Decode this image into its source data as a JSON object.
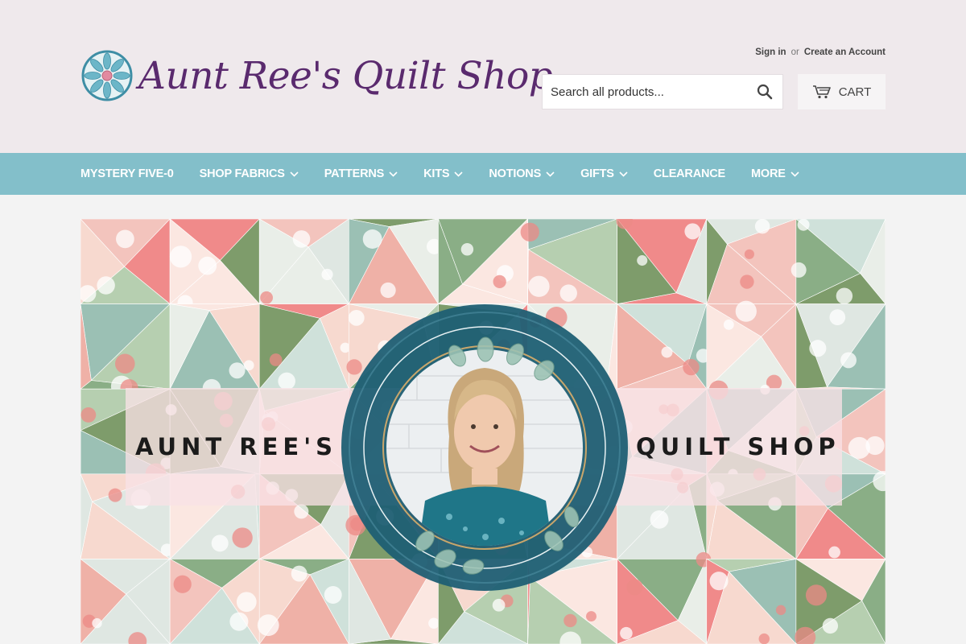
{
  "header": {
    "logo_text": "Aunt Ree's Quilt Shop",
    "sign_in": "Sign in",
    "or": "or",
    "create_account": "Create an Account",
    "search_placeholder": "Search all products...",
    "search_icon": "search-icon",
    "cart_label": "CART",
    "cart_icon": "cart-icon"
  },
  "nav": {
    "items": [
      {
        "label": "MYSTERY FIVE-0",
        "dropdown": false
      },
      {
        "label": "SHOP FABRICS",
        "dropdown": true
      },
      {
        "label": "PATTERNS",
        "dropdown": true
      },
      {
        "label": "KITS",
        "dropdown": true
      },
      {
        "label": "NOTIONS",
        "dropdown": true
      },
      {
        "label": "GIFTS",
        "dropdown": true
      },
      {
        "label": "CLEARANCE",
        "dropdown": false
      },
      {
        "label": "MORE",
        "dropdown": true
      }
    ]
  },
  "hero": {
    "left_text": "AUNT REE'S",
    "right_text": "QUILT SHOP"
  },
  "colors": {
    "header_bg": "#efe9ec",
    "nav_bg": "#83bfca",
    "logo_purple": "#5a2a6e",
    "badge_teal": "#1f5f74"
  }
}
